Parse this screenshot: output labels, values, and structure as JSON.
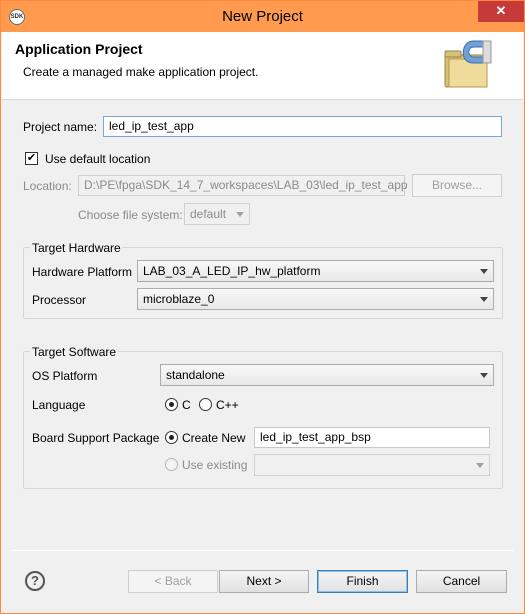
{
  "window": {
    "title": "New Project",
    "app_icon_text": "SDK",
    "close_glyph": "✕"
  },
  "header": {
    "title": "Application Project",
    "description": "Create a managed make application project."
  },
  "form": {
    "project_name_label": "Project name:",
    "project_name_value": "led_ip_test_app",
    "use_default_location_label": "Use default location",
    "use_default_location_checked": true,
    "location_label": "Location:",
    "location_value": "D:\\PE\\fpga\\SDK_14_7_workspaces\\LAB_03\\led_ip_test_app",
    "browse_label": "Browse...",
    "file_system_label": "Choose file system:",
    "file_system_value": "default"
  },
  "target_hardware": {
    "group_title": "Target Hardware",
    "platform_label": "Hardware Platform",
    "platform_value": "LAB_03_A_LED_IP_hw_platform",
    "processor_label": "Processor",
    "processor_value": "microblaze_0"
  },
  "target_software": {
    "group_title": "Target Software",
    "os_label": "OS Platform",
    "os_value": "standalone",
    "language_label": "Language",
    "language_options": [
      "C",
      "C++"
    ],
    "language_selected": "C",
    "bsp_label": "Board Support Package",
    "create_new_label": "Create New",
    "bsp_name_value": "led_ip_test_app_bsp",
    "use_existing_label": "Use existing",
    "existing_value": ""
  },
  "footer": {
    "help_glyph": "?",
    "back_label": "< Back",
    "next_label": "Next >",
    "finish_label": "Finish",
    "cancel_label": "Cancel"
  },
  "colors": {
    "titlebar": "#ff9a4e",
    "close_button": "#c73a3a",
    "focus_border": "#7aa7d6"
  }
}
